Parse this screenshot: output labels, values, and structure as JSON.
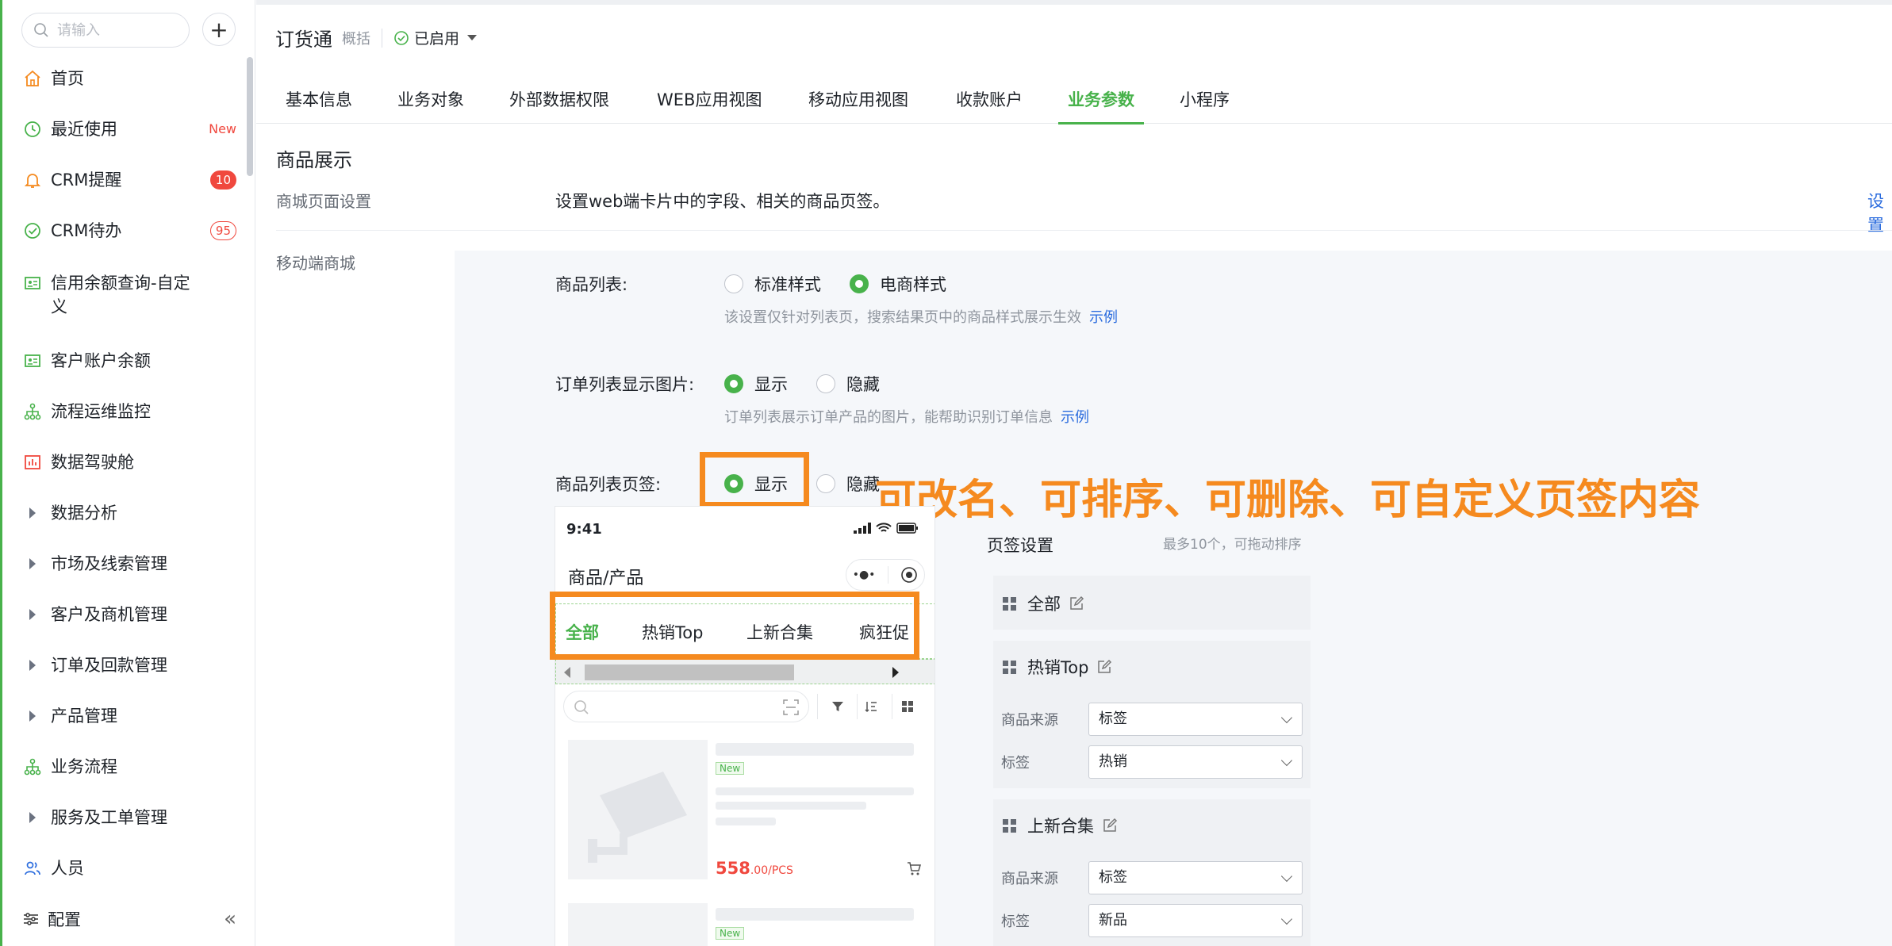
{
  "sidebar": {
    "search_placeholder": "请输入",
    "items": [
      {
        "label": "首页"
      },
      {
        "label": "最近使用",
        "badge": "New"
      },
      {
        "label": "CRM提醒",
        "badge": "10"
      },
      {
        "label": "CRM待办",
        "badge": "95"
      },
      {
        "label": "信用余额查询-自定",
        "label2": "义"
      },
      {
        "label": "客户账户余额"
      },
      {
        "label": "流程运维监控"
      },
      {
        "label": "数据驾驶舱"
      },
      {
        "label": "数据分析"
      },
      {
        "label": "市场及线索管理"
      },
      {
        "label": "客户及商机管理"
      },
      {
        "label": "订单及回款管理"
      },
      {
        "label": "产品管理"
      },
      {
        "label": "业务流程"
      },
      {
        "label": "服务及工单管理"
      },
      {
        "label": "人员"
      }
    ],
    "footer_label": "配置",
    "collapse_glyph": "«"
  },
  "header": {
    "title": "订货通",
    "subtitle": "概括",
    "status": "已启用"
  },
  "tabs": [
    "基本信息",
    "业务对象",
    "外部数据权限",
    "WEB应用视图",
    "移动应用视图",
    "收款账户",
    "业务参数",
    "小程序"
  ],
  "main": {
    "section_title": "商品展示",
    "row1_label": "商城页面设置",
    "row1_desc": "设置web端卡片中的字段、相关的商品页签。",
    "row1_link": "设置",
    "row2_label": "移动端商城",
    "opt1": {
      "label": "商品列表:",
      "a": "标准样式",
      "b": "电商样式",
      "hint": "该设置仅针对列表页，搜索结果页中的商品样式展示生效",
      "hint_link": "示例"
    },
    "opt2": {
      "label": "订单列表显示图片:",
      "a": "显示",
      "b": "隐藏",
      "hint": "订单列表展示订单产品的图片，能帮助识别订单信息",
      "hint_link": "示例"
    },
    "opt3": {
      "label": "商品列表页签:",
      "a": "显示",
      "b": "隐藏"
    },
    "annotation": "可改名、可排序、可删除、可自定义页签内容"
  },
  "phone": {
    "time": "9:41",
    "title": "商品/产品",
    "capsule_dots": "•●•",
    "tabs": [
      "全部",
      "热销Top",
      "上新合集",
      "疯狂促"
    ],
    "new_tag": "New",
    "price": "558",
    "price_unit": ".00/PCS"
  },
  "tagset": {
    "title": "页签设置",
    "hint": "最多10个，可拖动排序",
    "cards": [
      {
        "name": "全部"
      },
      {
        "name": "热销Top",
        "source_label": "商品来源",
        "source": "标签",
        "tag_label": "标签",
        "tag": "热销"
      },
      {
        "name": "上新合集",
        "source_label": "商品来源",
        "source": "标签",
        "tag_label": "标签",
        "tag": "新品"
      }
    ]
  },
  "colors": {
    "brand_green": "#48b24b",
    "annotation_orange": "#f58a1f",
    "link_blue": "#2b6cde",
    "badge_red": "#f0483e"
  }
}
